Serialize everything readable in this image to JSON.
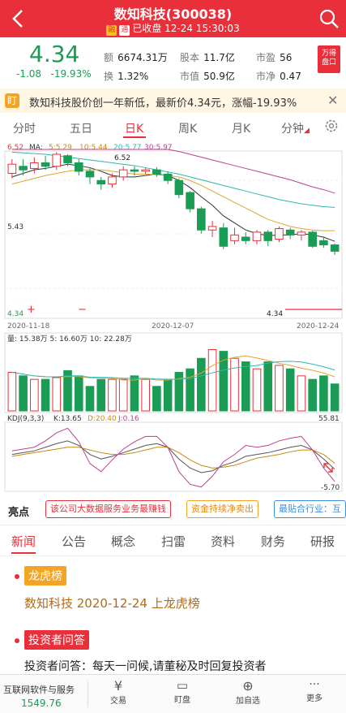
{
  "header": {
    "title": "数知科技(300038)",
    "tag1": "融",
    "tag2": "通",
    "status": "已收盘 12-24 15:30:03"
  },
  "quote": {
    "price": "4.34",
    "change": "-1.08",
    "change_pct": "-19.93%",
    "amount_label": "额",
    "amount": "6674.31万",
    "turnover_label": "换",
    "turnover": "1.32%",
    "shares_label": "股本",
    "shares": "11.7亿",
    "mcap_label": "市值",
    "mcap": "50.9亿",
    "pe_label": "市盈",
    "pe": "56",
    "pb_label": "市净",
    "pb": "0.47",
    "logo_line1": "万得",
    "logo_line2": "盘口"
  },
  "alert": {
    "icon": "盯",
    "text": "数知科技股价创一年新低，最新价4.34元，涨幅-19.93%"
  },
  "chart_tabs": [
    "分时",
    "五日",
    "日K",
    "周K",
    "月K",
    "分钟"
  ],
  "chart": {
    "ma_label": "MA:",
    "ma5": "5:5.29",
    "ma10": "10:5.44",
    "ma20": "20:5.77",
    "ma30": "30:5.97",
    "high": "6.52",
    "high_mark": "6.52",
    "mid": "5.43",
    "low": "4.34",
    "low_mark": "4.34",
    "dates": [
      "2020-11-18",
      "2020-12-07",
      "2020-12-24"
    ],
    "vol_label": "量: 15.38万  5: 16.60万  10: 22.28万",
    "kdj_label": "KDJ(9,3,3)",
    "k_label": "K:13.65",
    "d_label": "D:20.40",
    "j_label": "J:0.16",
    "kdj_high": "55.81",
    "kdj_low": "-5.70",
    "colors": {
      "up": "#e9303a",
      "down": "#1a9c54",
      "ma5": "#333333",
      "ma10": "#e0a52a",
      "ma20": "#2eb8b0",
      "ma30": "#c04090"
    }
  },
  "chart_data": {
    "type": "candlestick",
    "candles": [
      {
        "o": 6.25,
        "c": 6.38,
        "h": 6.45,
        "l": 6.18
      },
      {
        "o": 6.35,
        "c": 6.3,
        "h": 6.45,
        "l": 6.22
      },
      {
        "o": 6.32,
        "c": 6.4,
        "h": 6.48,
        "l": 6.25
      },
      {
        "o": 6.4,
        "c": 6.35,
        "h": 6.5,
        "l": 6.3
      },
      {
        "o": 6.35,
        "c": 6.52,
        "h": 6.55,
        "l": 6.3
      },
      {
        "o": 6.5,
        "c": 6.4,
        "h": 6.52,
        "l": 6.35
      },
      {
        "o": 6.4,
        "c": 6.28,
        "h": 6.45,
        "l": 6.22
      },
      {
        "o": 6.28,
        "c": 6.2,
        "h": 6.32,
        "l": 6.1
      },
      {
        "o": 6.15,
        "c": 6.1,
        "h": 6.2,
        "l": 6.02
      },
      {
        "o": 6.1,
        "c": 6.2,
        "h": 6.25,
        "l": 6.05
      },
      {
        "o": 6.2,
        "c": 6.3,
        "h": 6.35,
        "l": 6.15
      },
      {
        "o": 6.3,
        "c": 6.28,
        "h": 6.35,
        "l": 6.22
      },
      {
        "o": 6.28,
        "c": 6.3,
        "h": 6.33,
        "l": 6.24
      },
      {
        "o": 6.3,
        "c": 6.24,
        "h": 6.34,
        "l": 6.2
      },
      {
        "o": 6.24,
        "c": 6.15,
        "h": 6.28,
        "l": 6.1
      },
      {
        "o": 6.15,
        "c": 5.95,
        "h": 6.18,
        "l": 5.9
      },
      {
        "o": 5.98,
        "c": 5.75,
        "h": 6.0,
        "l": 5.7
      },
      {
        "o": 5.75,
        "c": 5.45,
        "h": 5.78,
        "l": 5.4
      },
      {
        "o": 5.45,
        "c": 5.5,
        "h": 5.58,
        "l": 5.35
      },
      {
        "o": 5.48,
        "c": 5.22,
        "h": 5.55,
        "l": 5.18
      },
      {
        "o": 5.3,
        "c": 5.38,
        "h": 5.48,
        "l": 5.25
      },
      {
        "o": 5.35,
        "c": 5.3,
        "h": 5.42,
        "l": 5.25
      },
      {
        "o": 5.3,
        "c": 5.42,
        "h": 5.45,
        "l": 5.25
      },
      {
        "o": 5.42,
        "c": 5.3,
        "h": 5.45,
        "l": 5.22
      },
      {
        "o": 5.32,
        "c": 5.47,
        "h": 5.5,
        "l": 5.28
      },
      {
        "o": 5.45,
        "c": 5.38,
        "h": 5.48,
        "l": 5.32
      },
      {
        "o": 5.38,
        "c": 5.42,
        "h": 5.45,
        "l": 5.3
      },
      {
        "o": 5.42,
        "c": 5.22,
        "h": 5.44,
        "l": 5.2
      },
      {
        "o": 5.3,
        "c": 5.24,
        "h": 5.35,
        "l": 5.2
      },
      {
        "o": 5.24,
        "c": 5.15,
        "h": 5.26,
        "l": 5.1
      }
    ],
    "ma5": [
      6.2,
      6.25,
      6.3,
      6.32,
      6.35,
      6.38,
      6.36,
      6.33,
      6.28,
      6.22,
      6.2,
      6.2,
      6.22,
      6.24,
      6.22,
      6.15,
      6.05,
      5.92,
      5.8,
      5.65,
      5.55,
      5.45,
      5.4,
      5.37,
      5.38,
      5.38,
      5.4,
      5.38,
      5.35,
      5.29
    ],
    "ma10": [
      6.1,
      6.14,
      6.18,
      6.22,
      6.25,
      6.28,
      6.3,
      6.3,
      6.3,
      6.28,
      6.26,
      6.24,
      6.24,
      6.23,
      6.22,
      6.2,
      6.15,
      6.08,
      6.0,
      5.92,
      5.84,
      5.76,
      5.68,
      5.6,
      5.55,
      5.5,
      5.47,
      5.45,
      5.44,
      5.44
    ],
    "ma20": [
      6.55,
      6.54,
      6.53,
      6.52,
      6.5,
      6.48,
      6.46,
      6.44,
      6.42,
      6.4,
      6.38,
      6.36,
      6.33,
      6.3,
      6.27,
      6.24,
      6.2,
      6.16,
      6.12,
      6.08,
      6.04,
      6.0,
      5.96,
      5.92,
      5.88,
      5.85,
      5.82,
      5.8,
      5.78,
      5.77
    ],
    "ma30": [
      7.0,
      6.98,
      6.95,
      6.92,
      6.9,
      6.87,
      6.84,
      6.81,
      6.78,
      6.75,
      6.72,
      6.69,
      6.66,
      6.63,
      6.6,
      6.56,
      6.52,
      6.48,
      6.44,
      6.4,
      6.36,
      6.32,
      6.28,
      6.24,
      6.2,
      6.16,
      6.11,
      6.06,
      6.02,
      5.97
    ],
    "volume": [
      22,
      20,
      18,
      18,
      19,
      23,
      20,
      14,
      18,
      18,
      18,
      20,
      18,
      14,
      18,
      22,
      24,
      30,
      35,
      34,
      30,
      28,
      24,
      28,
      26,
      24,
      20,
      18,
      20,
      15.38
    ],
    "k": [
      30,
      32,
      34,
      38,
      42,
      45,
      40,
      30,
      25,
      28,
      32,
      36,
      40,
      42,
      38,
      25,
      15,
      10,
      12,
      18,
      22,
      28,
      30,
      32,
      35,
      38,
      40,
      35,
      25,
      13.65
    ],
    "d": [
      28,
      30,
      32,
      34,
      36,
      38,
      38,
      35,
      32,
      30,
      30,
      32,
      35,
      38,
      38,
      32,
      24,
      18,
      15,
      16,
      18,
      22,
      26,
      28,
      30,
      33,
      35,
      35,
      30,
      20.4
    ],
    "j": [
      34,
      36,
      38,
      45,
      54,
      59,
      44,
      20,
      11,
      24,
      36,
      44,
      50,
      50,
      38,
      11,
      -3,
      -6,
      6,
      22,
      30,
      40,
      38,
      40,
      45,
      48,
      50,
      35,
      15,
      0.16
    ],
    "price_range": [
      4.34,
      6.52
    ]
  },
  "highlights": {
    "label": "亮点",
    "chips": [
      {
        "text": "该公司大数据服务业务最赚钱",
        "color": "#e9303a"
      },
      {
        "text": "资金持续净卖出",
        "color": "#f3a424"
      },
      {
        "text": "最贴合行业：互",
        "color": "#3a8fd8"
      }
    ]
  },
  "news_tabs": [
    "新闻",
    "公告",
    "概念",
    "扫雷",
    "资料",
    "财务",
    "研报"
  ],
  "news": [
    {
      "badge": "龙虎榜",
      "text": "数知科技 2020-12-24 上龙虎榜"
    },
    {
      "badge": "投资者问答",
      "text": "投资者问答：每天一问候,请董秘及时回复投资者"
    }
  ],
  "bottom_bar": {
    "index_name": "互联网软件与服务",
    "index_value": "1549.76",
    "items": [
      "交易",
      "盯盘",
      "加自选",
      "更多"
    ]
  }
}
